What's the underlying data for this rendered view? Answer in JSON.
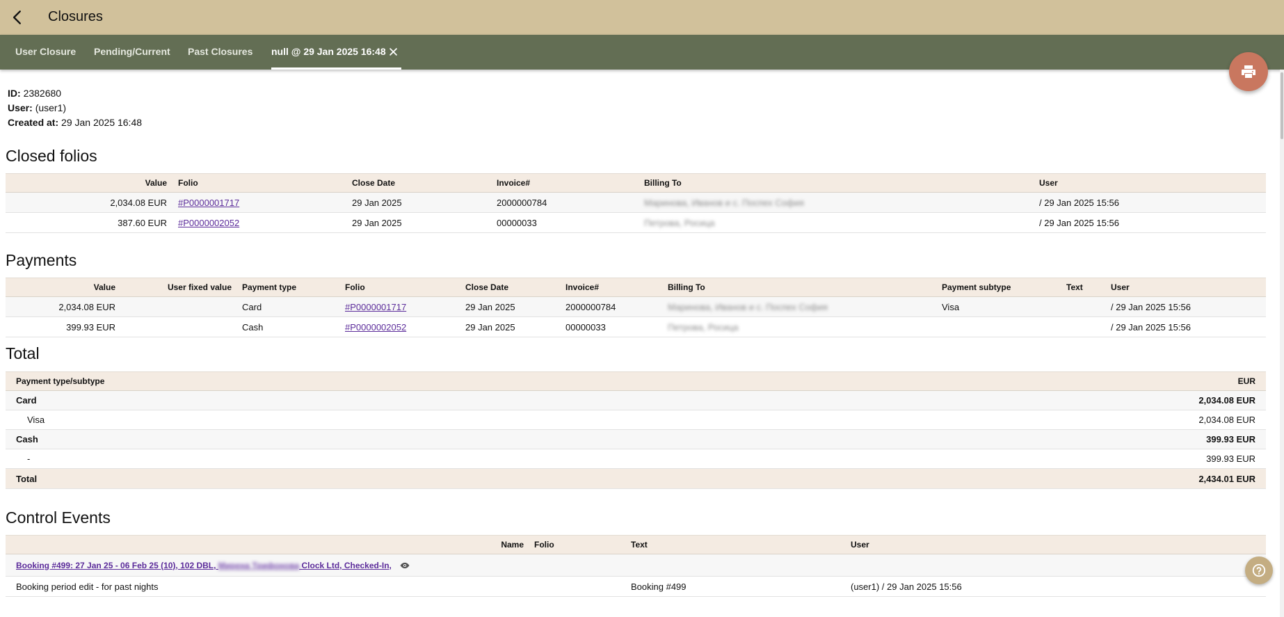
{
  "header": {
    "title": "Closures",
    "back_icon": "arrow-back-icon"
  },
  "tabs": [
    {
      "label": "User Closure"
    },
    {
      "label": "Pending/Current"
    },
    {
      "label": "Past Closures"
    },
    {
      "label": "null @ 29 Jan 2025 16:48",
      "active": true
    }
  ],
  "info": {
    "id_label": "ID:",
    "id_value": "2382680",
    "user_label": "User:",
    "user_value": "(user1)",
    "created_label": "Created at:",
    "created_value": "29 Jan 2025 16:48"
  },
  "closed_folios": {
    "title": "Closed folios",
    "columns": [
      "Value",
      "Folio",
      "Close Date",
      "Invoice#",
      "Billing To",
      "User"
    ],
    "rows": [
      {
        "value": "2,034.08 EUR",
        "folio": "#P0000001717",
        "close_date": "29 Jan 2025",
        "invoice": "2000000784",
        "billing_to": "Маринова, Иванов и с. Поспех София",
        "user": "/ 29 Jan 2025 15:56"
      },
      {
        "value": "387.60 EUR",
        "folio": "#P0000002052",
        "close_date": "29 Jan 2025",
        "invoice": "00000033",
        "billing_to": "Петрова, Росица",
        "user": "/ 29 Jan 2025 15:56"
      }
    ]
  },
  "payments": {
    "title": "Payments",
    "columns": [
      "Value",
      "User fixed value",
      "Payment type",
      "Folio",
      "Close Date",
      "Invoice#",
      "Billing To",
      "Payment subtype",
      "Text",
      "User"
    ],
    "rows": [
      {
        "value": "2,034.08 EUR",
        "fixed": "",
        "type": "Card",
        "folio": "#P0000001717",
        "close_date": "29 Jan 2025",
        "invoice": "2000000784",
        "billing_to": "Маринова, Иванов и с. Поспех София",
        "subtype": "Visa",
        "text": "",
        "user": "/ 29 Jan 2025 15:56"
      },
      {
        "value": "399.93 EUR",
        "fixed": "",
        "type": "Cash",
        "folio": "#P0000002052",
        "close_date": "29 Jan 2025",
        "invoice": "00000033",
        "billing_to": "Петрова, Росица",
        "subtype": "",
        "text": "",
        "user": "/ 29 Jan 2025 15:56"
      }
    ]
  },
  "total": {
    "title": "Total",
    "col_type": "Payment type/subtype",
    "col_currency": "EUR",
    "rows": [
      {
        "label": "Card",
        "amount": "2,034.08 EUR",
        "bold": true
      },
      {
        "label": "Visa",
        "amount": "2,034.08 EUR",
        "bold": false
      },
      {
        "label": "Cash",
        "amount": "399.93 EUR",
        "bold": true
      },
      {
        "label": "-",
        "amount": "399.93 EUR",
        "bold": false
      },
      {
        "label": "Total",
        "amount": "2,434.01 EUR",
        "bold": true
      }
    ]
  },
  "control_events": {
    "title": "Control Events",
    "columns": [
      "Name",
      "Folio",
      "Text",
      "User"
    ],
    "booking_link": "Booking #499: 27 Jan 25 - 06 Feb 25 (10), 102 DBL, Мирена Трифонова, Clock Ltd, Checked-In,",
    "booking_link_prefix": "Booking #499: 27 Jan 25 - 06 Feb 25 (10), 102 DBL,",
    "booking_link_hidden": "Мирена Трифонова",
    "booking_link_suffix": "Clock Ltd, Checked-In,",
    "event": {
      "name": "Booking period edit - for past nights",
      "folio": "",
      "text": "Booking #499",
      "user": "(user1) / 29 Jan 2025 15:56"
    }
  },
  "icons": {
    "print": "print-icon",
    "help": "help-icon",
    "view": "eye-icon",
    "close_tab": "close-icon"
  },
  "colors": {
    "topbar": "#d1c19b",
    "tabbar": "#636e54",
    "header_row": "#f4ebe2",
    "fab": "#c9775f",
    "link": "#5b2b9a"
  }
}
